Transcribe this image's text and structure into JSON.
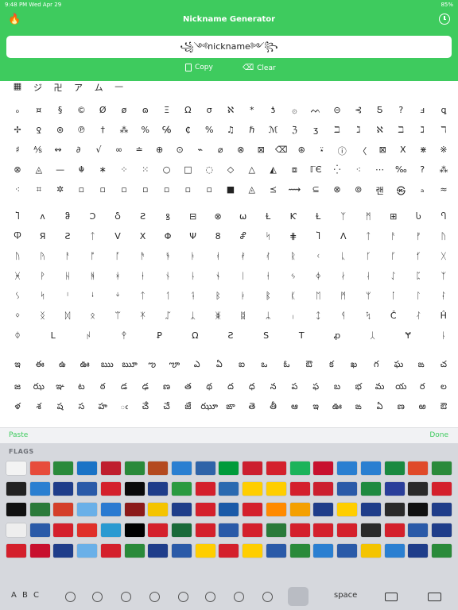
{
  "status": {
    "time": "9:48 PM  Wed Apr 29",
    "battery": "85%"
  },
  "header": {
    "title": "Nickname Generator"
  },
  "input": {
    "value": "꧁༺nickname༻꧂"
  },
  "actions": {
    "copy": "Copy",
    "clear": "Clear"
  },
  "grid_rows": [
    [
      "▦",
      "ジ",
      "卍",
      "ア",
      "ム",
      "—",
      "",
      "",
      "",
      "",
      "",
      "",
      "",
      "",
      "",
      "",
      "",
      "",
      "",
      "",
      "",
      ""
    ],
    [
      "ₒ",
      "¤",
      "§",
      "©",
      "Ø",
      "ø",
      "ɷ",
      "Ξ",
      "Ω",
      "σ",
      "ℵ",
      "*",
      "ƾ",
      "۞",
      "ᨓ",
      "⊝",
      "⊰",
      "Ƽ",
      "?",
      "ⅎ",
      "ꝗ"
    ],
    [
      "✢",
      "Ꝿ",
      "⊚",
      "℗",
      "†",
      "⁂",
      "%",
      "℅",
      "₵",
      "%",
      "♫",
      "ℏ",
      "ℳ",
      "ℨ",
      "ʒ",
      "ℶ",
      "ℷ",
      "ℵ",
      "ℶ",
      "ℷ",
      "ℸ"
    ],
    [
      "♯",
      "⅍",
      "↭",
      "∂",
      "√",
      "∞",
      "≐",
      "⊕",
      "⊙",
      "⌁",
      "⌀",
      "⊗",
      "⊠",
      "⌫",
      "⊛",
      "⍣",
      "ⓘ",
      "〈",
      "⊠",
      "X",
      "⋇",
      "※"
    ],
    [
      "⊗",
      "◬",
      "—",
      "☬",
      "∗",
      "⁘",
      "⁙",
      "○",
      "□",
      "◌",
      "◇",
      "△",
      "◭",
      "⧈",
      "ℾЄ",
      "⁛",
      "⁖",
      "⋯",
      "‰",
      "?",
      "⁂"
    ],
    [
      "⁖",
      "⌗",
      "✲",
      "▫",
      "▫",
      "▫",
      "▫",
      "▫",
      "▫",
      "▫",
      "■",
      "◬",
      "⪯",
      "⟿",
      "⊆",
      "⊗",
      "⊚",
      "랜",
      "㉿",
      "ₐ",
      "≈"
    ],
    [
      "Ⴈ",
      "ʌ",
      "ჵ",
      "Ɔ",
      "Ⴢ",
      "Ꙅ",
      "ꝸ",
      "⊟",
      "⊗",
      "⍵",
      "Ɫ",
      "Ƙ",
      "Ɫ",
      "ᛉ",
      "ᛗ",
      "⊞",
      "Ⴑ",
      "Ⴄ"
    ],
    [
      "Ⴔ",
      "Я",
      "Ꙅ",
      "ᛏ",
      "V",
      "X",
      "Φ",
      "Ψ",
      "8",
      "Ⴥ",
      "ᛋ",
      "⋕",
      "Ⴈ",
      "Λ",
      "ᛏ",
      "ᚨ",
      "ᚠ",
      "ᚢ"
    ],
    [
      "ᚢ",
      "ᚤ",
      "ᚨ",
      "ᚩ",
      "ᚪ",
      "ᚫ",
      "ᚬ",
      "ᚭ",
      "ᚮ",
      "ᚯ",
      "ᚰ",
      "ᚱ",
      "ᚲ",
      "ᚳ",
      "ᚴ",
      "ᚵ",
      "ᚶ",
      "ᚷ"
    ],
    [
      "ᚸ",
      "ᚹ",
      "ᚺ",
      "ᚻ",
      "ᚼ",
      "ᚽ",
      "ᚾ",
      "ᚿ",
      "ᛀ",
      "ᛁ",
      "ᛂ",
      "ᛃ",
      "ᛄ",
      "ᛅ",
      "ᛆ",
      "ᛇ",
      "ᛈ",
      "ᛉ"
    ],
    [
      "ᛊ",
      "ᛋ",
      "ᛌ",
      "ᛍ",
      "ᛎ",
      "ᛏ",
      "ᛐ",
      "ᛑ",
      "ᛒ",
      "ᛓ",
      "ᛔ",
      "ᛕ",
      "ᛖ",
      "ᛗ",
      "ᛘ",
      "ᛙ",
      "ᛚ",
      "ᛛ"
    ],
    [
      "ᛜ",
      "ᛝ",
      "ᛞ",
      "ᛟ",
      "ᛠ",
      "ᛡ",
      "ᛢ",
      "ᛣ",
      "ᛤ",
      "ᛥ",
      "ᛦ",
      "ᛧ",
      "ᛨ",
      "ᛩ",
      "ᛪ",
      "Č",
      "ᛮ",
      "Ĥ"
    ],
    [
      "ᛰ",
      "L",
      "ᛲ",
      "ᛳ",
      "Ꝑ",
      "Ω",
      "Ꙅ",
      "S",
      "T",
      "ꝓ",
      "ᛸ",
      "Ɏ",
      "ᚿ"
    ],
    [
      "ఇ",
      "ఈ",
      "ఉ",
      "ఊ",
      "ఋ",
      "ౠ",
      "ఌ",
      "ౡ",
      "ఎ",
      "ఏ",
      "ఐ",
      "ఒ",
      "ఓ",
      "ఔ",
      "క",
      "ఖ",
      "గ",
      "ఘ",
      "ఙ",
      "చ"
    ],
    [
      "జ",
      "ఝ",
      "ఞ",
      "ట",
      "ఠ",
      "డ",
      "ఢ",
      "ణ",
      "త",
      "థ",
      "ద",
      "ధ",
      "న",
      "ప",
      "ఫ",
      "బ",
      "భ",
      "మ",
      "య",
      "ర",
      "ల"
    ],
    [
      "ళ",
      "శ",
      "ష",
      "స",
      "హ",
      "ఁ",
      "ౘ",
      "చే",
      "జే",
      "ఝూ",
      "ఙా",
      "తె",
      "తీ",
      "ఆ",
      "ఇ",
      "ఊ",
      "ఙ",
      "ఏ",
      "ణ",
      "ఱ",
      "ఔ"
    ]
  ],
  "bar": {
    "paste": "Paste",
    "done": "Done"
  },
  "keyboard": {
    "category": "FLAGS",
    "abc": "A B C",
    "space": "space"
  },
  "flags": [
    [
      "#f3f3f3",
      "#e74c3c",
      "#2a8a3a",
      "#1a73c6",
      "#bf1e2e",
      "#2a8a3a",
      "#b44a1f",
      "#2a7fd1",
      "#2f64a8",
      "#009b3a",
      "#cc1f2f",
      "#d4202c",
      "#1bb35a",
      "#c8102e",
      "#2a7fd1",
      "#2a7fd1",
      "#1a8a40",
      "#e04a2a",
      "#2a8a3a"
    ],
    [
      "#222222",
      "#2a7fd1",
      "#1f3d8a",
      "#2a5aa8",
      "#d4202c",
      "#0a0a0a",
      "#1f3d8a",
      "#2a9a40",
      "#d4202c",
      "#2a6ab0",
      "#ffce00",
      "#ffce00",
      "#d4202c",
      "#cc1f2f",
      "#2a5aa8",
      "#1f8a40",
      "#2a3e9a",
      "#2a2a2a",
      "#d4202c"
    ],
    [
      "#111111",
      "#2a7a3a",
      "#d43e2a",
      "#6ab0e8",
      "#2a7ad1",
      "#8c1a1a",
      "#f4c400",
      "#1f3d8a",
      "#d4202c",
      "#1a5aa8",
      "#d4202c",
      "#ff8a00",
      "#f4a000",
      "#1f3d8a",
      "#ffce00",
      "#1f3d8a",
      "#2a2a2a",
      "#111111",
      "#1f3d8a"
    ],
    [
      "#eeeeee",
      "#2a5aa8",
      "#d4202c",
      "#e0302a",
      "#2a9ad1",
      "#000000",
      "#d4202c",
      "#1a6a3a",
      "#d4202c",
      "#2a5aa8",
      "#d4202c",
      "#2a7a3a",
      "#d4202c",
      "#d4202c",
      "#d4202c",
      "#2a2a2a",
      "#d4202c",
      "#2a5aa8",
      "#1f3d8a"
    ],
    [
      "#d4202c",
      "#c8102e",
      "#1f3d8a",
      "#6ab0e8",
      "#d4202c",
      "#2a8a3a",
      "#1f3d8a",
      "#2a5aa8",
      "#ffce00",
      "#d4202c",
      "#ffce00",
      "#2a5aa8",
      "#2a8a3a",
      "#2a7fd1",
      "#2a5aa8",
      "#f4c400",
      "#2a7fd1",
      "#1f3d8a",
      "#2a8a3a"
    ]
  ]
}
